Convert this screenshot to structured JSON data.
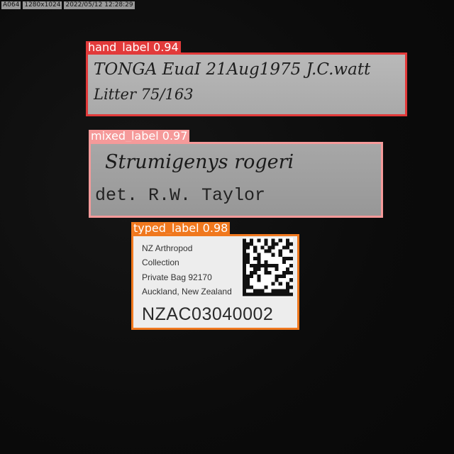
{
  "hud": {
    "camera_id": "A064",
    "resolution": "1280x1024",
    "timestamp": "2022/05/12 12:28:29"
  },
  "detections": [
    {
      "key": "hand",
      "class_name": "hand_label",
      "confidence": "0.94",
      "tag": "hand_label 0.94",
      "color": "#e23a3a",
      "lines": [
        "TONGA EuaI 21Aug1975 J.C.watt",
        "Litter 75/163"
      ]
    },
    {
      "key": "mixed",
      "class_name": "mixed_label",
      "confidence": "0.97",
      "tag": "mixed_label 0.97",
      "color": "#f59a9a",
      "species": "Strumigenys rogeri",
      "determiner": "det. R.W. Taylor"
    },
    {
      "key": "typed",
      "class_name": "typed_label",
      "confidence": "0.98",
      "tag": "typed_label 0.98",
      "color": "#f0781e",
      "address": [
        "NZ Arthropod",
        "Collection",
        "Private Bag 92170",
        "Auckland, New Zealand"
      ],
      "catalog_number": "NZAC03040002",
      "code_icon": "datamatrix-barcode-icon"
    }
  ]
}
